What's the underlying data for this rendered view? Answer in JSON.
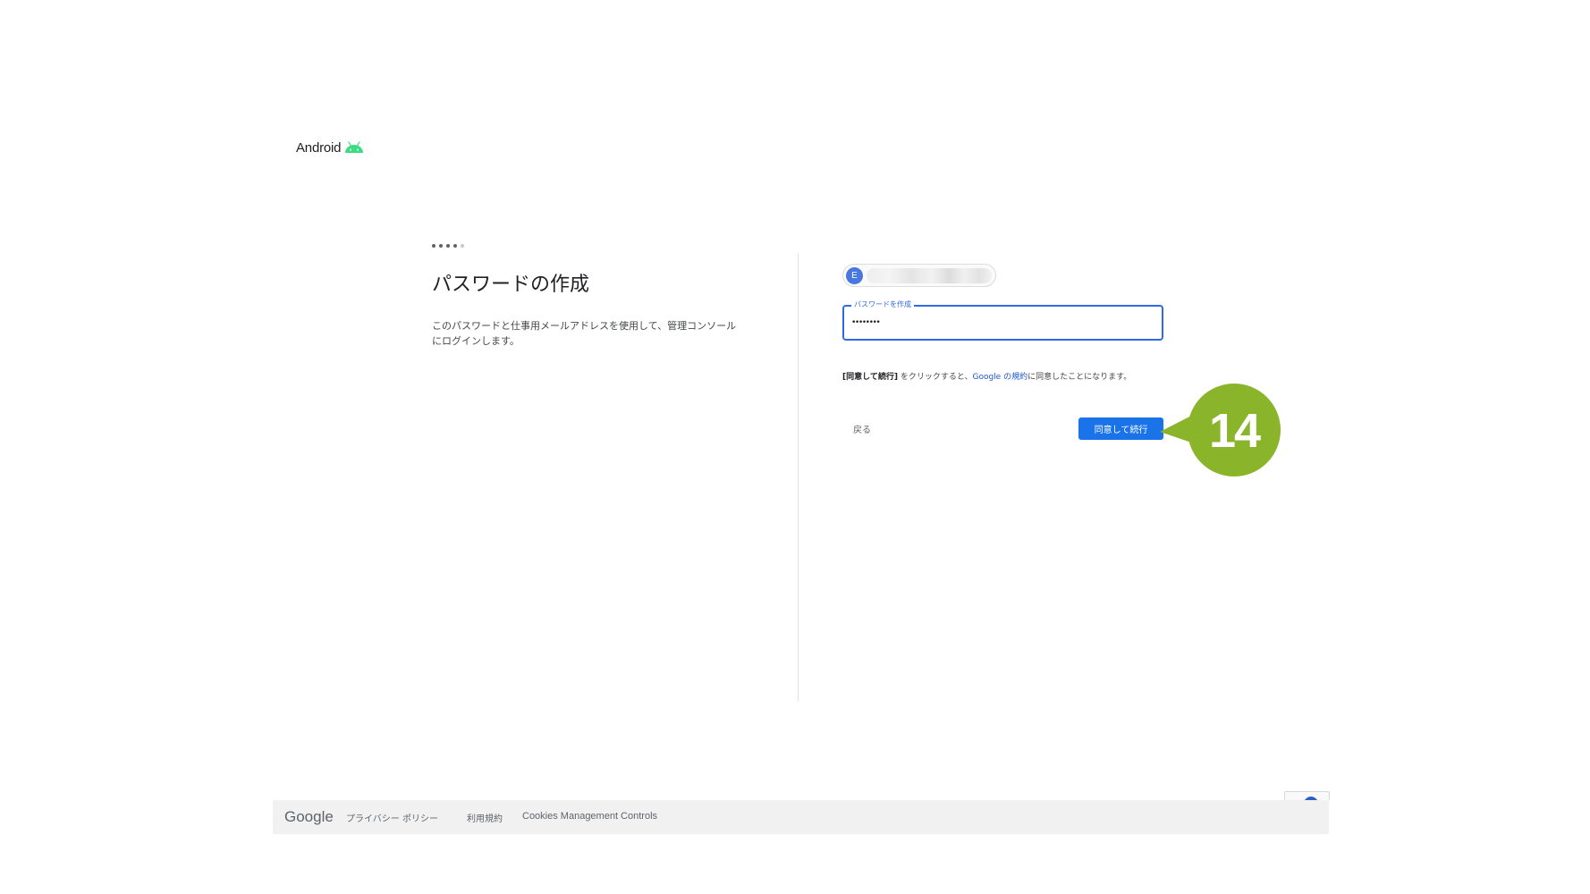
{
  "brand": {
    "name": "Android",
    "logo_icon": "android-robot-icon",
    "logo_color": "#3ddc84"
  },
  "progress": {
    "total_steps": 5,
    "current_step": 4
  },
  "page": {
    "title": "パスワードの作成",
    "description_line1": "このパスワードと仕事用メールアドレスを使用して、管理コンソール",
    "description_line2": "にログインします。"
  },
  "account": {
    "avatar_letter": "E"
  },
  "password": {
    "label": "パスワードを作成",
    "value": "••••••••"
  },
  "terms": {
    "bold": "[同意して続行]",
    "middle": " をクリックすると、",
    "link": "Google の規約",
    "end": "に同意したことになります。"
  },
  "buttons": {
    "back": "戻る",
    "agree": "同意して続行"
  },
  "annotation": {
    "step_number": "14",
    "color": "#8ab52a"
  },
  "footer": {
    "logo": "Google",
    "privacy": "プライバシー ポリシー",
    "terms": "利用規約",
    "cookies": "Cookies Management Controls"
  },
  "colors": {
    "primary": "#1a73e8",
    "focus": "#2f6ae0",
    "footer_bg": "#f1f1f1"
  }
}
